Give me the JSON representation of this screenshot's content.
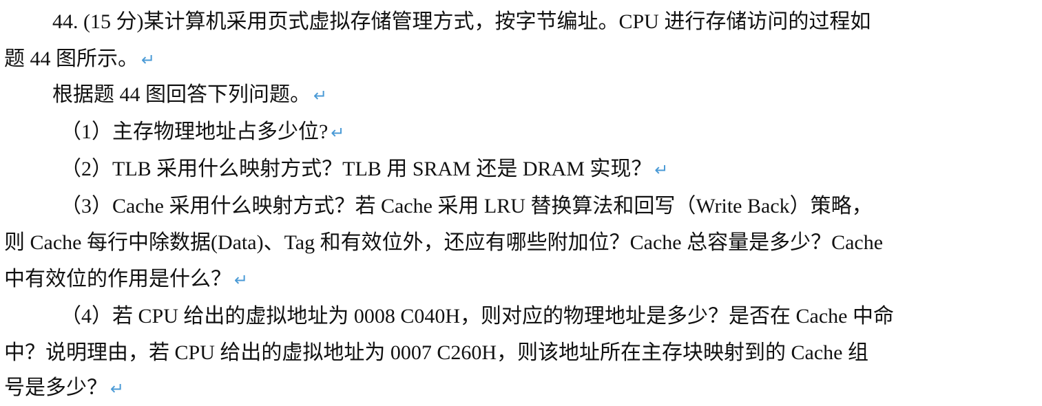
{
  "question": {
    "intro_line1": "44. (15 分)某计算机采用页式虚拟存储管理方式，按字节编址。CPU 进行存储访问的过程如",
    "intro_line2": "题 44 图所示。",
    "instruction": "根据题 44 图回答下列问题。",
    "q1": "（1）主存物理地址占多少位?",
    "q2": "（2）TLB 采用什么映射方式？TLB 用 SRAM 还是 DRAM 实现？",
    "q3_line1": "（3）Cache 采用什么映射方式？若  Cache 采用 LRU 替换算法和回写（Write  Back）策略，",
    "q3_line2": "则 Cache 每行中除数据(Data)、Tag 和有效位外，还应有哪些附加位？Cache 总容量是多少？Cache",
    "q3_line3": "中有效位的作用是什么？",
    "q4_line1": "（4）若 CPU 给出的虚拟地址为 0008 C040H，则对应的物理地址是多少？是否在 Cache 中命",
    "q4_line2": "中？说明理由，若 CPU 给出的虚拟地址为 0007 C260H，则该地址所在主存块映射到的 Cache 组",
    "q4_line3": "号是多少？"
  },
  "return_mark": "↵",
  "colors": {
    "text": "#111111",
    "return_mark": "#4a9ad6",
    "background": "#ffffff"
  }
}
